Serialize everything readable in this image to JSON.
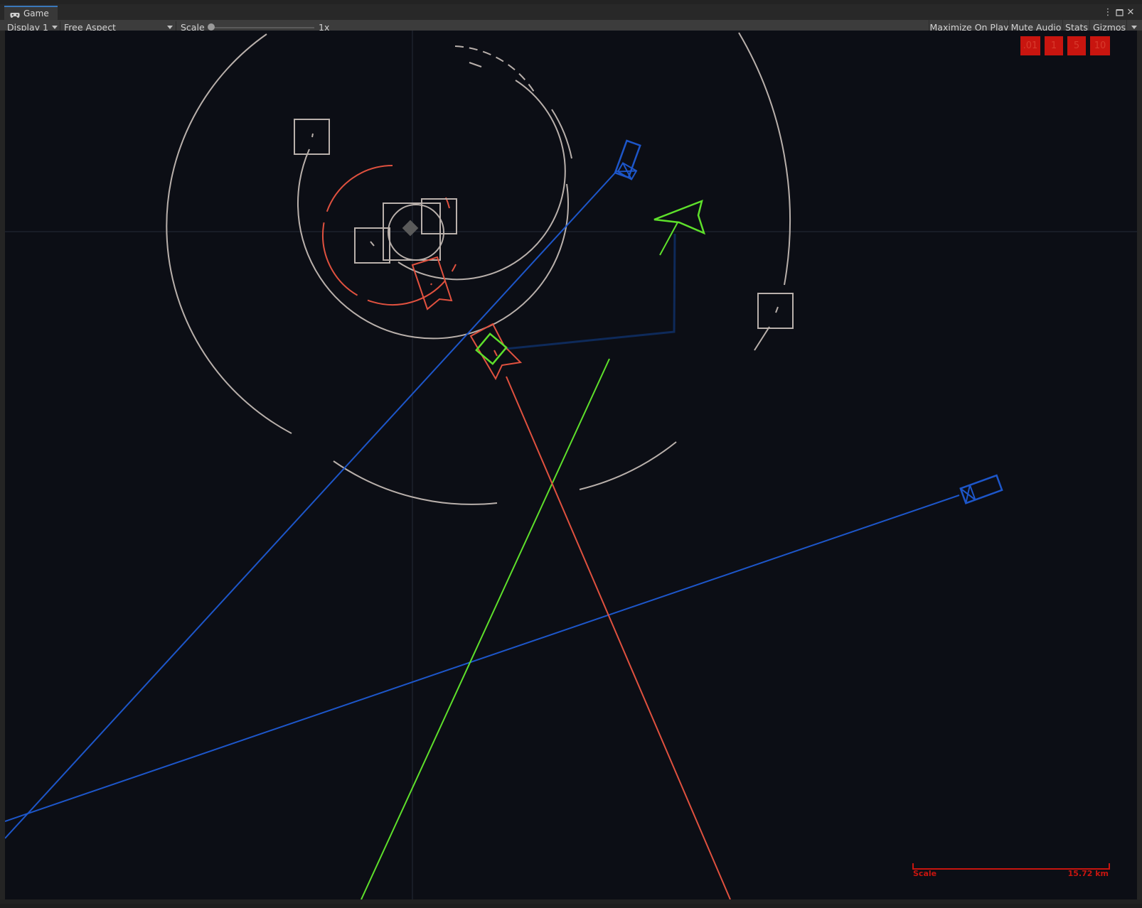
{
  "window": {
    "tab_label": "Game",
    "tab_icon": "gamepad-icon",
    "menu_icon": "kebab-menu-icon",
    "maximize_icon": "maximize-icon",
    "close_icon": "close-icon"
  },
  "toolbar": {
    "display": "Display 1",
    "aspect": "Free Aspect",
    "scale_label": "Scale",
    "scale_value": "1x",
    "scale_fraction": 0.0,
    "maximize_on_play": "Maximize On Play",
    "mute_audio": "Mute Audio",
    "stats": "Stats",
    "gizmos": "Gizmos"
  },
  "time_controls": [
    ".01",
    "1",
    "5",
    "10"
  ],
  "scale_bar": {
    "label": "Scale",
    "value": "15.72 km"
  },
  "colors": {
    "background": "#0c0e15",
    "orbit": "#b9b0ab",
    "enemy_red": "#e0513f",
    "player_green": "#5ee02b",
    "allied_blue": "#1d56c9",
    "dark_blue": "#0e2a5a",
    "accent_red": "#c8150f"
  }
}
